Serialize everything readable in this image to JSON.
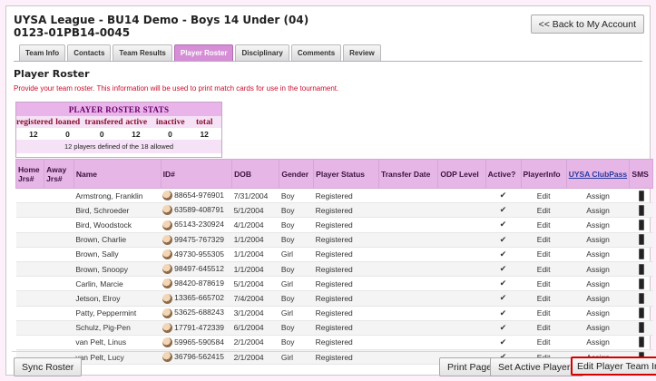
{
  "header": {
    "title_line1": "UYSA League - BU14 Demo - Boys 14 Under (04)",
    "title_line2": "0123-01PB14-0045",
    "back_button": "<< Back to My Account"
  },
  "tabs": [
    {
      "label": "Team Info",
      "active": false
    },
    {
      "label": "Contacts",
      "active": false
    },
    {
      "label": "Team Results",
      "active": false
    },
    {
      "label": "Player Roster",
      "active": true
    },
    {
      "label": "Disciplinary",
      "active": false
    },
    {
      "label": "Comments",
      "active": false
    },
    {
      "label": "Review",
      "active": false
    }
  ],
  "section_title": "Player Roster",
  "instructions": "Provide your team roster. This information will be used to print match cards for use in the tournament.",
  "stats": {
    "title": "PLAYER ROSTER STATS",
    "headers": [
      "registered",
      "loaned",
      "transfered",
      "active",
      "inactive",
      "total"
    ],
    "values": [
      "12",
      "0",
      "0",
      "12",
      "0",
      "12"
    ],
    "note": "12 players defined of the 18 allowed"
  },
  "table": {
    "columns": {
      "home": "Home Jrs#",
      "away": "Away Jrs#",
      "name": "Name",
      "id": "ID#",
      "dob": "DOB",
      "gender": "Gender",
      "status": "Player Status",
      "transfer": "Transfer Date",
      "odp": "ODP Level",
      "active": "Active?",
      "playerinfo": "PlayerInfo",
      "clubpass": "UYSA ClubPass",
      "sms": "SMS"
    },
    "rows": [
      {
        "name": "Armstrong, Franklin",
        "id": "88654-976901",
        "dob": "7/31/2004",
        "gender": "Boy",
        "status": "Registered",
        "active": "✔",
        "edit": "Edit",
        "assign": "Assign"
      },
      {
        "name": "Bird, Schroeder",
        "id": "63589-408791",
        "dob": "5/1/2004",
        "gender": "Boy",
        "status": "Registered",
        "active": "✔",
        "edit": "Edit",
        "assign": "Assign"
      },
      {
        "name": "Bird, Woodstock",
        "id": "65143-230924",
        "dob": "4/1/2004",
        "gender": "Boy",
        "status": "Registered",
        "active": "✔",
        "edit": "Edit",
        "assign": "Assign"
      },
      {
        "name": "Brown, Charlie",
        "id": "99475-767329",
        "dob": "1/1/2004",
        "gender": "Boy",
        "status": "Registered",
        "active": "✔",
        "edit": "Edit",
        "assign": "Assign"
      },
      {
        "name": "Brown, Sally",
        "id": "49730-955305",
        "dob": "1/1/2004",
        "gender": "Girl",
        "status": "Registered",
        "active": "✔",
        "edit": "Edit",
        "assign": "Assign"
      },
      {
        "name": "Brown, Snoopy",
        "id": "98497-645512",
        "dob": "1/1/2004",
        "gender": "Boy",
        "status": "Registered",
        "active": "✔",
        "edit": "Edit",
        "assign": "Assign"
      },
      {
        "name": "Carlin, Marcie",
        "id": "98420-878619",
        "dob": "5/1/2004",
        "gender": "Girl",
        "status": "Registered",
        "active": "✔",
        "edit": "Edit",
        "assign": "Assign"
      },
      {
        "name": "Jetson, Elroy",
        "id": "13365-665702",
        "dob": "7/4/2004",
        "gender": "Boy",
        "status": "Registered",
        "active": "✔",
        "edit": "Edit",
        "assign": "Assign"
      },
      {
        "name": "Patty, Peppermint",
        "id": "53625-688243",
        "dob": "3/1/2004",
        "gender": "Girl",
        "status": "Registered",
        "active": "✔",
        "edit": "Edit",
        "assign": "Assign"
      },
      {
        "name": "Schulz, Pig-Pen",
        "id": "17791-472339",
        "dob": "6/1/2004",
        "gender": "Boy",
        "status": "Registered",
        "active": "✔",
        "edit": "Edit",
        "assign": "Assign"
      },
      {
        "name": "van Pelt, Linus",
        "id": "59965-590584",
        "dob": "2/1/2004",
        "gender": "Boy",
        "status": "Registered",
        "active": "✔",
        "edit": "Edit",
        "assign": "Assign"
      },
      {
        "name": "van Pelt, Lucy",
        "id": "36796-562415",
        "dob": "2/1/2004",
        "gender": "Girl",
        "status": "Registered",
        "active": "✔",
        "edit": "Edit",
        "assign": "Assign"
      }
    ]
  },
  "footer": {
    "sync": "Sync Roster",
    "print": "Print Page",
    "set_active": "Set Active Players",
    "edit_info": "Edit Player Team Info"
  },
  "icons": {
    "avatar": "player-avatar-icon",
    "sms": "phone-icon"
  },
  "colors": {
    "header_pink": "#e6b6e6",
    "active_tab": "#d68fd6",
    "instructions": "#c8102e",
    "highlight_border": "#d40000"
  }
}
